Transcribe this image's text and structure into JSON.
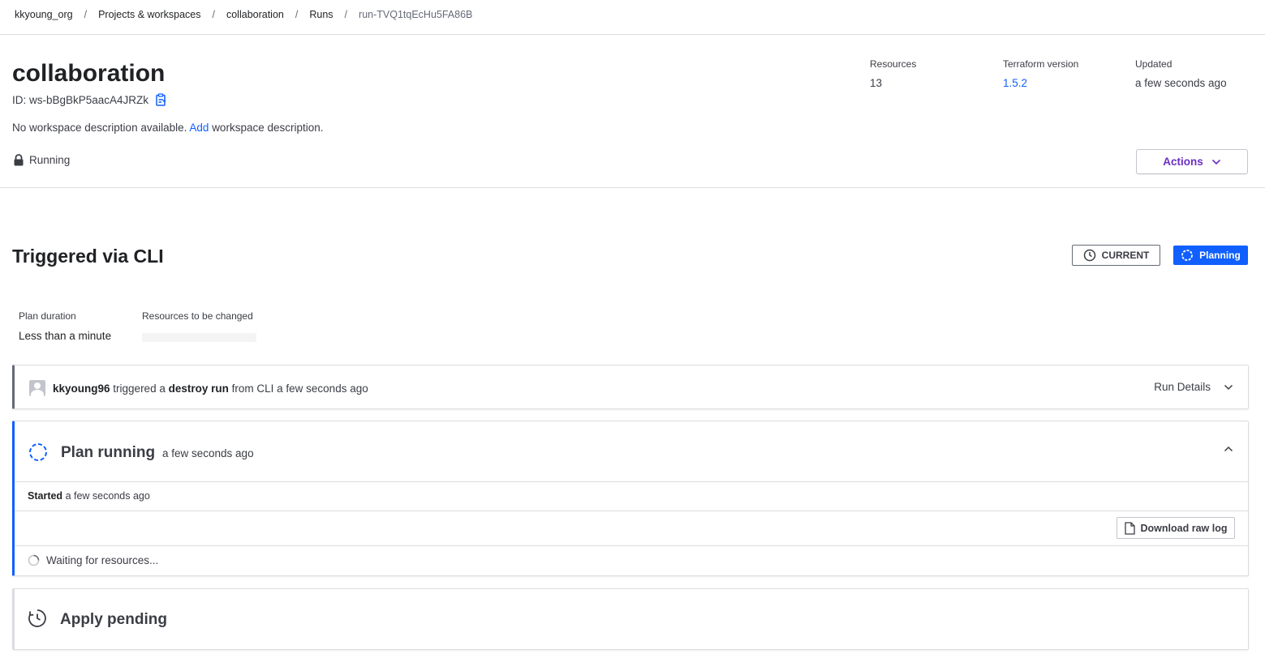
{
  "breadcrumb": {
    "items": [
      "kkyoung_org",
      "Projects & workspaces",
      "collaboration",
      "Runs",
      "run-TVQ1tqEcHu5FA86B"
    ],
    "separator": "/"
  },
  "workspace": {
    "title": "collaboration",
    "id_text": "ID: ws-bBgBkP5aacA4JRZk",
    "description_prefix": "No workspace description available.",
    "description_link": "Add",
    "description_suffix": "workspace description.",
    "lock_status": "Running",
    "meta": {
      "resources_label": "Resources",
      "resources_value": "13",
      "tf_version_label": "Terraform version",
      "tf_version_value": "1.5.2",
      "updated_label": "Updated",
      "updated_value": "a few seconds ago"
    },
    "actions_label": "Actions"
  },
  "run": {
    "title": "Triggered via CLI",
    "current_badge": "CURRENT",
    "status_badge": "Planning",
    "plan_duration_label": "Plan duration",
    "plan_duration_value": "Less than a minute",
    "resources_changed_label": "Resources to be changed",
    "trigger": {
      "user": "kkyoung96",
      "text1": "triggered a",
      "run_type": "destroy run",
      "text2": "from CLI a few seconds ago",
      "details_label": "Run Details"
    },
    "plan": {
      "title": "Plan running",
      "time": "a few seconds ago",
      "started_bold": "Started",
      "started_rest": "a few seconds ago",
      "download_label": "Download raw log",
      "waiting_text": "Waiting for resources..."
    },
    "apply": {
      "title": "Apply pending"
    }
  },
  "colors": {
    "accent_blue": "#1060ff",
    "actions_purple": "#6b2fc2",
    "border": "#dcdde1",
    "text": "#3b3d45"
  },
  "icons": {
    "copy": "clipboard-copy-icon",
    "lock": "lock-icon",
    "chevron_down": "chevron-down-icon",
    "chevron_up": "chevron-up-icon",
    "clock": "clock-icon",
    "spinner": "loading-icon",
    "file": "file-icon",
    "avatar": "user-avatar"
  }
}
